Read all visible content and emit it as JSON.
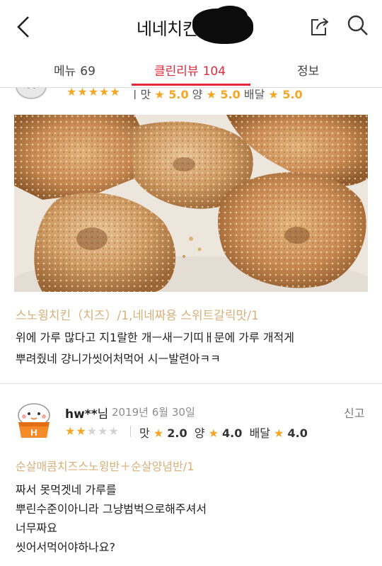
{
  "header": {
    "title": "네네치킨",
    "back_icon": "chevron-left-icon",
    "share_icon": "share-icon",
    "search_icon": "search-icon"
  },
  "tabs": [
    {
      "label": "메뉴",
      "count": "69",
      "active": false
    },
    {
      "label": "클린리뷰",
      "count": "104",
      "active": true
    },
    {
      "label": "정보",
      "count": "",
      "active": false
    }
  ],
  "colors": {
    "accent": "#e5283a",
    "star": "#f5a623",
    "order_text": "#d8b07a"
  },
  "review1": {
    "avatar_letter": "M",
    "stars": "★★★★★",
    "rating": 5,
    "scores_text": {
      "taste_label": "맛",
      "taste": "5.0",
      "amount_label": "양",
      "amount": "5.0",
      "delivery_label": "배달",
      "delivery": "5.0"
    },
    "order": "스노윙치킨（치즈）/1,네네짜용 스위트갈릭맛/1",
    "body_lines": [
      "위에 가루 많다고 지1랄한 개ㅡ새ㅡ기띠ㅐ문에 가루 개적게",
      "뿌려줬네 걍니가씻어처먹어 시ㅡ발련아ㅋㅋ"
    ]
  },
  "review2": {
    "avatar_letter": "H",
    "name": "hw**",
    "name_suffix": "님",
    "date": "2019년 6월 30일",
    "report": "신고",
    "stars_on": "★★",
    "stars_off": "★★★",
    "rating": 2,
    "taste_label": "맛",
    "taste": "2.0",
    "amount_label": "양",
    "amount": "4.0",
    "delivery_label": "배달",
    "delivery": "4.0",
    "order": "순살매콤치즈스노윙반＋순살양념반/1",
    "body_lines": [
      "짜서 못먹겟네 가루를",
      "뿌린수준이아니라 그냥범벅으로해주셔서",
      "너무짜요",
      "씻어서먹어야하나요?"
    ]
  }
}
